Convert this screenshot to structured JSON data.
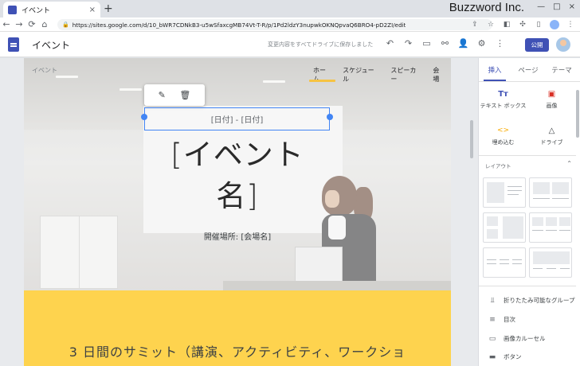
{
  "browser": {
    "tab_title": "イベント",
    "tab_close": "×",
    "new_tab": "+",
    "brand": "Buzzword Inc.",
    "window_buttons": [
      "—",
      "□",
      "×"
    ],
    "nav": {
      "back": "←",
      "forward": "→",
      "reload": "⟳",
      "home": "⌂"
    },
    "url": "https://sites.google.com/d/10_bWR7CDNkB3-u5wSfaxcgMB74Vt-T-R/p/1Pd2ldzY3nupwkOKNQpvaQ6BRO4-pD2ZI/edit",
    "lock": "🔒"
  },
  "editor": {
    "site_name": "イベント",
    "save_status": "変更内容をすべてドライブに保存しました",
    "publish_label": "公開",
    "tool_icons": [
      "↶",
      "↷",
      "▭",
      "⚯",
      "👤",
      "⚙",
      "⋮"
    ]
  },
  "page": {
    "logo_hint": "イベント",
    "nav_items": [
      "ホーム",
      "スケジュール",
      "スピーカー",
      "会場"
    ],
    "edit_icons": {
      "pencil": "✎",
      "trash": "🗑"
    },
    "date_text": "[日付] - [日付]",
    "title_line1": "[イベント",
    "title_line2": "名]",
    "venue_text": "開催場所: [会場名]",
    "summit_text": "3 日間のサミット（講演、アクティビティ、ワークショ"
  },
  "panel": {
    "tabs": [
      "挿入",
      "ページ",
      "テーマ"
    ],
    "insert_items": [
      {
        "icon": "Tт",
        "label": "テキスト ボックス",
        "color": "#3f51b5"
      },
      {
        "icon": "▣",
        "label": "画像",
        "color": "#d93025"
      },
      {
        "icon": "<>",
        "label": "埋め込む",
        "color": "#f9ab00"
      },
      {
        "icon": "△",
        "label": "ドライブ",
        "color": "#3c4043"
      }
    ],
    "layout_label": "レイアウト",
    "layout_chevron": "⌃",
    "components": [
      {
        "icon": "⫫",
        "label": "折りたたみ可能なグループ"
      },
      {
        "icon": "≡",
        "label": "目次"
      },
      {
        "icon": "▭",
        "label": "画像カルーセル"
      },
      {
        "icon": "▬",
        "label": "ボタン"
      }
    ]
  }
}
